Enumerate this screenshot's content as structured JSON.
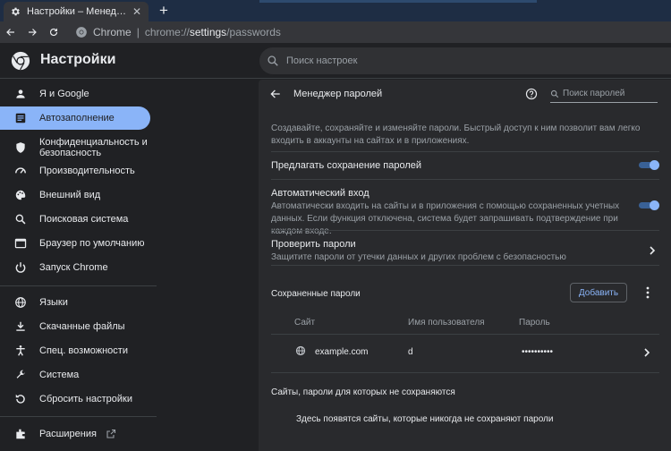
{
  "browser": {
    "tab_title": "Настройки – Менеджер паролей",
    "tab_close": "✕",
    "new_tab": "+",
    "omnibox_chrome_label": "Chrome",
    "omnibox_separator": "|",
    "url_scheme": "chrome://",
    "url_host": "settings",
    "url_path": "/passwords"
  },
  "header": {
    "title": "Настройки",
    "search_placeholder": "Поиск настроек"
  },
  "sidebar": {
    "items": [
      {
        "label": "Я и Google",
        "icon": "person-icon"
      },
      {
        "label": "Автозаполнение",
        "icon": "autofill-icon",
        "active": true
      },
      {
        "label": "Конфиденциальность и безопасность",
        "icon": "shield-icon"
      },
      {
        "label": "Производительность",
        "icon": "speed-icon"
      },
      {
        "label": "Внешний вид",
        "icon": "palette-icon"
      },
      {
        "label": "Поисковая система",
        "icon": "search-icon"
      },
      {
        "label": "Браузер по умолчанию",
        "icon": "browser-icon"
      },
      {
        "label": "Запуск Chrome",
        "icon": "power-icon"
      },
      {
        "label": "Языки",
        "icon": "globe-icon"
      },
      {
        "label": "Скачанные файлы",
        "icon": "download-icon"
      },
      {
        "label": "Спец. возможности",
        "icon": "accessibility-icon"
      },
      {
        "label": "Система",
        "icon": "wrench-icon"
      },
      {
        "label": "Сбросить настройки",
        "icon": "reset-icon"
      },
      {
        "label": "Расширения",
        "icon": "extensions-icon"
      }
    ]
  },
  "main": {
    "title": "Менеджер паролей",
    "search_placeholder": "Поиск паролей",
    "description": "Создавайте, сохраняйте и изменяйте пароли. Быстрый доступ к ним позволит вам легко входить в аккаунты на сайтах и в приложениях.",
    "offer_save": {
      "label": "Предлагать сохранение паролей",
      "enabled": true
    },
    "auto_signin": {
      "label": "Автоматический вход",
      "sub": "Автоматически входить на сайты и в приложения с помощью сохраненных учетных данных. Если функция отключена, система будет запрашивать подтверждение при каждом входе.",
      "enabled": true
    },
    "check": {
      "label": "Проверить пароли",
      "sub": "Защитите пароли от утечки данных и других проблем с безопасностью"
    },
    "saved": {
      "title": "Сохраненные пароли",
      "add_label": "Добавить",
      "columns": [
        "Сайт",
        "Имя пользователя",
        "Пароль"
      ],
      "rows": [
        {
          "site": "example.com",
          "username": "d",
          "password": "••••••••••"
        }
      ]
    },
    "never_saved": {
      "title": "Сайты, пароли для которых не сохраняются",
      "empty": "Здесь появятся сайты, которые никогда не сохраняют пароли"
    }
  },
  "colors": {
    "accent": "#8ab4f8",
    "background": "#202124",
    "card": "#292a2d"
  }
}
